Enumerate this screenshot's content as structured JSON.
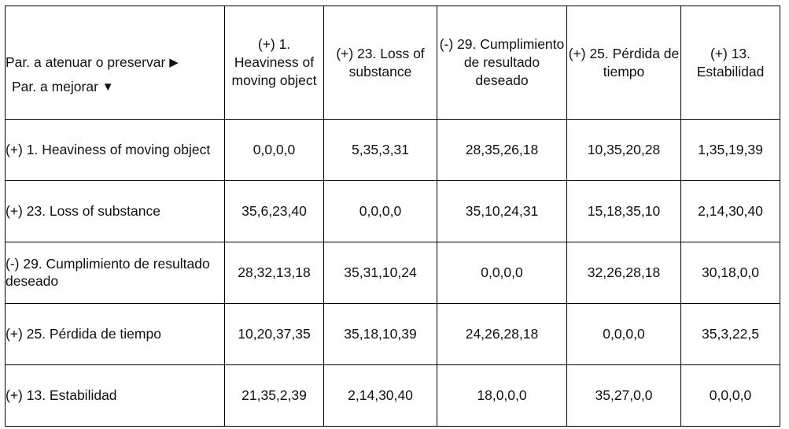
{
  "table": {
    "corner": {
      "top_label": "Par. a atenuar o preservar",
      "top_arrow": "▶",
      "bottom_label": "Par. a mejorar",
      "bottom_arrow": "▼"
    },
    "column_headers": [
      "(+) 1. Heaviness of moving object",
      "(+) 23. Loss of substance",
      "(-) 29. Cumplimiento de resultado deseado",
      "(+) 25. Pérdida de tiempo",
      "(+) 13. Estabilidad"
    ],
    "row_headers": [
      "(+) 1. Heaviness of moving object",
      "(+) 23.  Loss of substance",
      "(-) 29. Cumplimiento de resultado deseado",
      "(+) 25. Pérdida de tiempo",
      "(+) 13. Estabilidad"
    ],
    "rows": [
      {
        "header": "(+) 1. Heaviness of moving object",
        "cells": [
          "0,0,0,0",
          "5,35,3,31",
          "28,35,26,18",
          "10,35,20,28",
          "1,35,19,39"
        ]
      },
      {
        "header": "(+) 23.  Loss of substance",
        "cells": [
          "35,6,23,40",
          "0,0,0,0",
          "35,10,24,31",
          "15,18,35,10",
          "2,14,30,40"
        ]
      },
      {
        "header": "(-) 29. Cumplimiento de resultado deseado",
        "cells": [
          "28,32,13,18",
          "35,31,10,24",
          "0,0,0,0",
          "32,26,28,18",
          "30,18,0,0"
        ]
      },
      {
        "header": "(+) 25. Pérdida de tiempo",
        "cells": [
          "10,20,37,35",
          "35,18,10,39",
          "24,26,28,18",
          "0,0,0,0",
          "35,3,22,5"
        ]
      },
      {
        "header": "(+) 13. Estabilidad",
        "cells": [
          "21,35,2,39",
          "2,14,30,40",
          "18,0,0,0",
          "35,27,0,0",
          "0,0,0,0"
        ]
      }
    ]
  },
  "colors": {
    "border": "#000000",
    "text": "#111111",
    "background": "#ffffff"
  }
}
